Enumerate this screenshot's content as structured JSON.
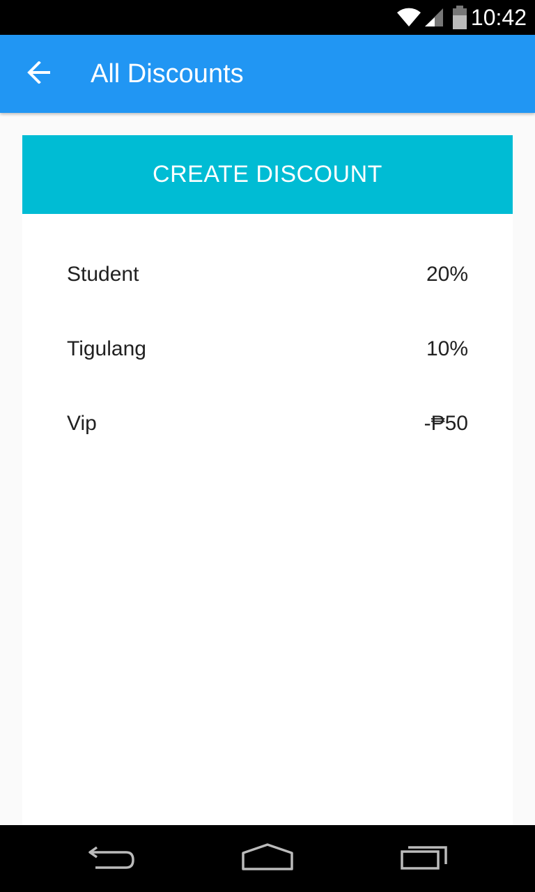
{
  "status_bar": {
    "time": "10:42",
    "icons": [
      "wifi-icon",
      "signal-icon",
      "battery-icon"
    ]
  },
  "app_bar": {
    "title": "All Discounts",
    "back_icon": "arrow-back-icon",
    "color": "#2196f3"
  },
  "actions": {
    "create_label": "CREATE DISCOUNT",
    "create_color": "#00bcd4"
  },
  "discounts": [
    {
      "name": "Student",
      "value": "20%"
    },
    {
      "name": "Tigulang",
      "value": "10%"
    },
    {
      "name": "Vip",
      "value": "-₱50"
    }
  ],
  "nav_bar": {
    "icons": [
      "back-icon",
      "home-icon",
      "recents-icon"
    ]
  }
}
